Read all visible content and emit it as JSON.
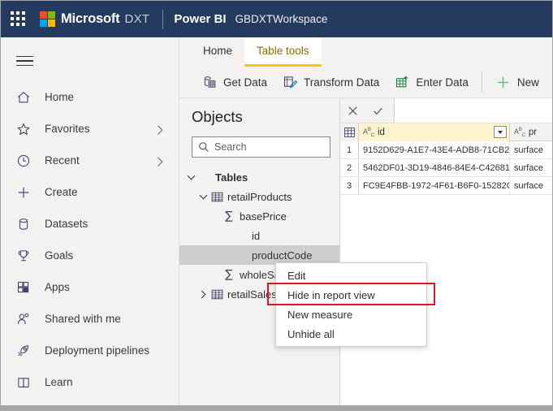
{
  "header": {
    "waffle_icon": "waffle-grid-icon",
    "logo_icon": "microsoft-logo-icon",
    "brand": "Microsoft",
    "brand_suffix": "DXT",
    "product": "Power BI",
    "workspace": "GBDXTWorkspace",
    "bg_color": "#243a5e"
  },
  "sidebar": {
    "menu_icon": "hamburger-icon",
    "items": [
      {
        "label": "Home",
        "icon": "home-icon",
        "chevron": false
      },
      {
        "label": "Favorites",
        "icon": "star-icon",
        "chevron": true
      },
      {
        "label": "Recent",
        "icon": "clock-icon",
        "chevron": true
      },
      {
        "label": "Create",
        "icon": "plus-icon",
        "chevron": false
      },
      {
        "label": "Datasets",
        "icon": "database-icon",
        "chevron": false
      },
      {
        "label": "Goals",
        "icon": "trophy-icon",
        "chevron": false
      },
      {
        "label": "Apps",
        "icon": "apps-grid-icon",
        "chevron": false
      },
      {
        "label": "Shared with me",
        "icon": "people-icon",
        "chevron": false
      },
      {
        "label": "Deployment pipelines",
        "icon": "rocket-icon",
        "chevron": false
      },
      {
        "label": "Learn",
        "icon": "book-icon",
        "chevron": false
      }
    ]
  },
  "ribbon": {
    "tabs": [
      {
        "label": "Home",
        "active": false
      },
      {
        "label": "Table tools",
        "active": true
      }
    ],
    "active_tab_underline_color": "#f2c811",
    "commands": [
      {
        "label": "Get Data",
        "icon": "get-data-icon"
      },
      {
        "label": "Transform Data",
        "icon": "transform-data-icon"
      },
      {
        "label": "Enter Data",
        "icon": "enter-data-icon"
      },
      {
        "label": "New",
        "icon": "plus-icon"
      }
    ]
  },
  "objects_pane": {
    "title": "Objects",
    "search": {
      "placeholder": "Search",
      "value": "",
      "icon": "search-icon"
    },
    "tree": [
      {
        "label": "Tables",
        "indent": 0,
        "icon": "none",
        "chevron": "down",
        "bold": true,
        "selected": false
      },
      {
        "label": "retailProducts",
        "indent": 1,
        "icon": "table",
        "chevron": "down",
        "bold": false,
        "selected": false
      },
      {
        "label": "basePrice",
        "indent": 2,
        "icon": "measure",
        "chevron": "none",
        "bold": false,
        "selected": false
      },
      {
        "label": "id",
        "indent": 3,
        "icon": "none",
        "chevron": "none",
        "bold": false,
        "selected": false
      },
      {
        "label": "productCode",
        "indent": 3,
        "icon": "none",
        "chevron": "none",
        "bold": false,
        "selected": true
      },
      {
        "label": "wholeSal",
        "indent": 2,
        "icon": "measure",
        "chevron": "none",
        "bold": false,
        "selected": false
      },
      {
        "label": "retailSales",
        "indent": 1,
        "icon": "table",
        "chevron": "right",
        "bold": false,
        "selected": false
      }
    ]
  },
  "context_menu": {
    "items": [
      {
        "label": "Edit",
        "highlighted": false
      },
      {
        "label": "Hide in report view",
        "highlighted": true
      },
      {
        "label": "New measure",
        "highlighted": false
      },
      {
        "label": "Unhide all",
        "highlighted": false
      }
    ],
    "highlight_color": "#e81123"
  },
  "data_grid": {
    "formula_bar": {
      "cancel_icon": "close-x-icon",
      "confirm_icon": "checkmark-icon",
      "value": ""
    },
    "corner_icon": "table-grid-icon",
    "columns": [
      {
        "name": "id",
        "type_icon": "abc-text-icon",
        "selected": true,
        "has_filter_dropdown": true
      },
      {
        "name": "pr",
        "type_icon": "abc-text-icon",
        "selected": false,
        "has_filter_dropdown": false
      }
    ],
    "selected_column_color": "#fdf3ce",
    "rows": [
      {
        "num": "1",
        "id": "9152D629-A1E7-43E4-ADB8-71CB2...",
        "pr": "surface"
      },
      {
        "num": "2",
        "id": "5462DF01-3D19-4846-84E4-C42681...",
        "pr": "surface"
      },
      {
        "num": "3",
        "id": "FC9E4FBB-1972-4F61-B6F0-15282C2...",
        "pr": "surface"
      }
    ]
  }
}
